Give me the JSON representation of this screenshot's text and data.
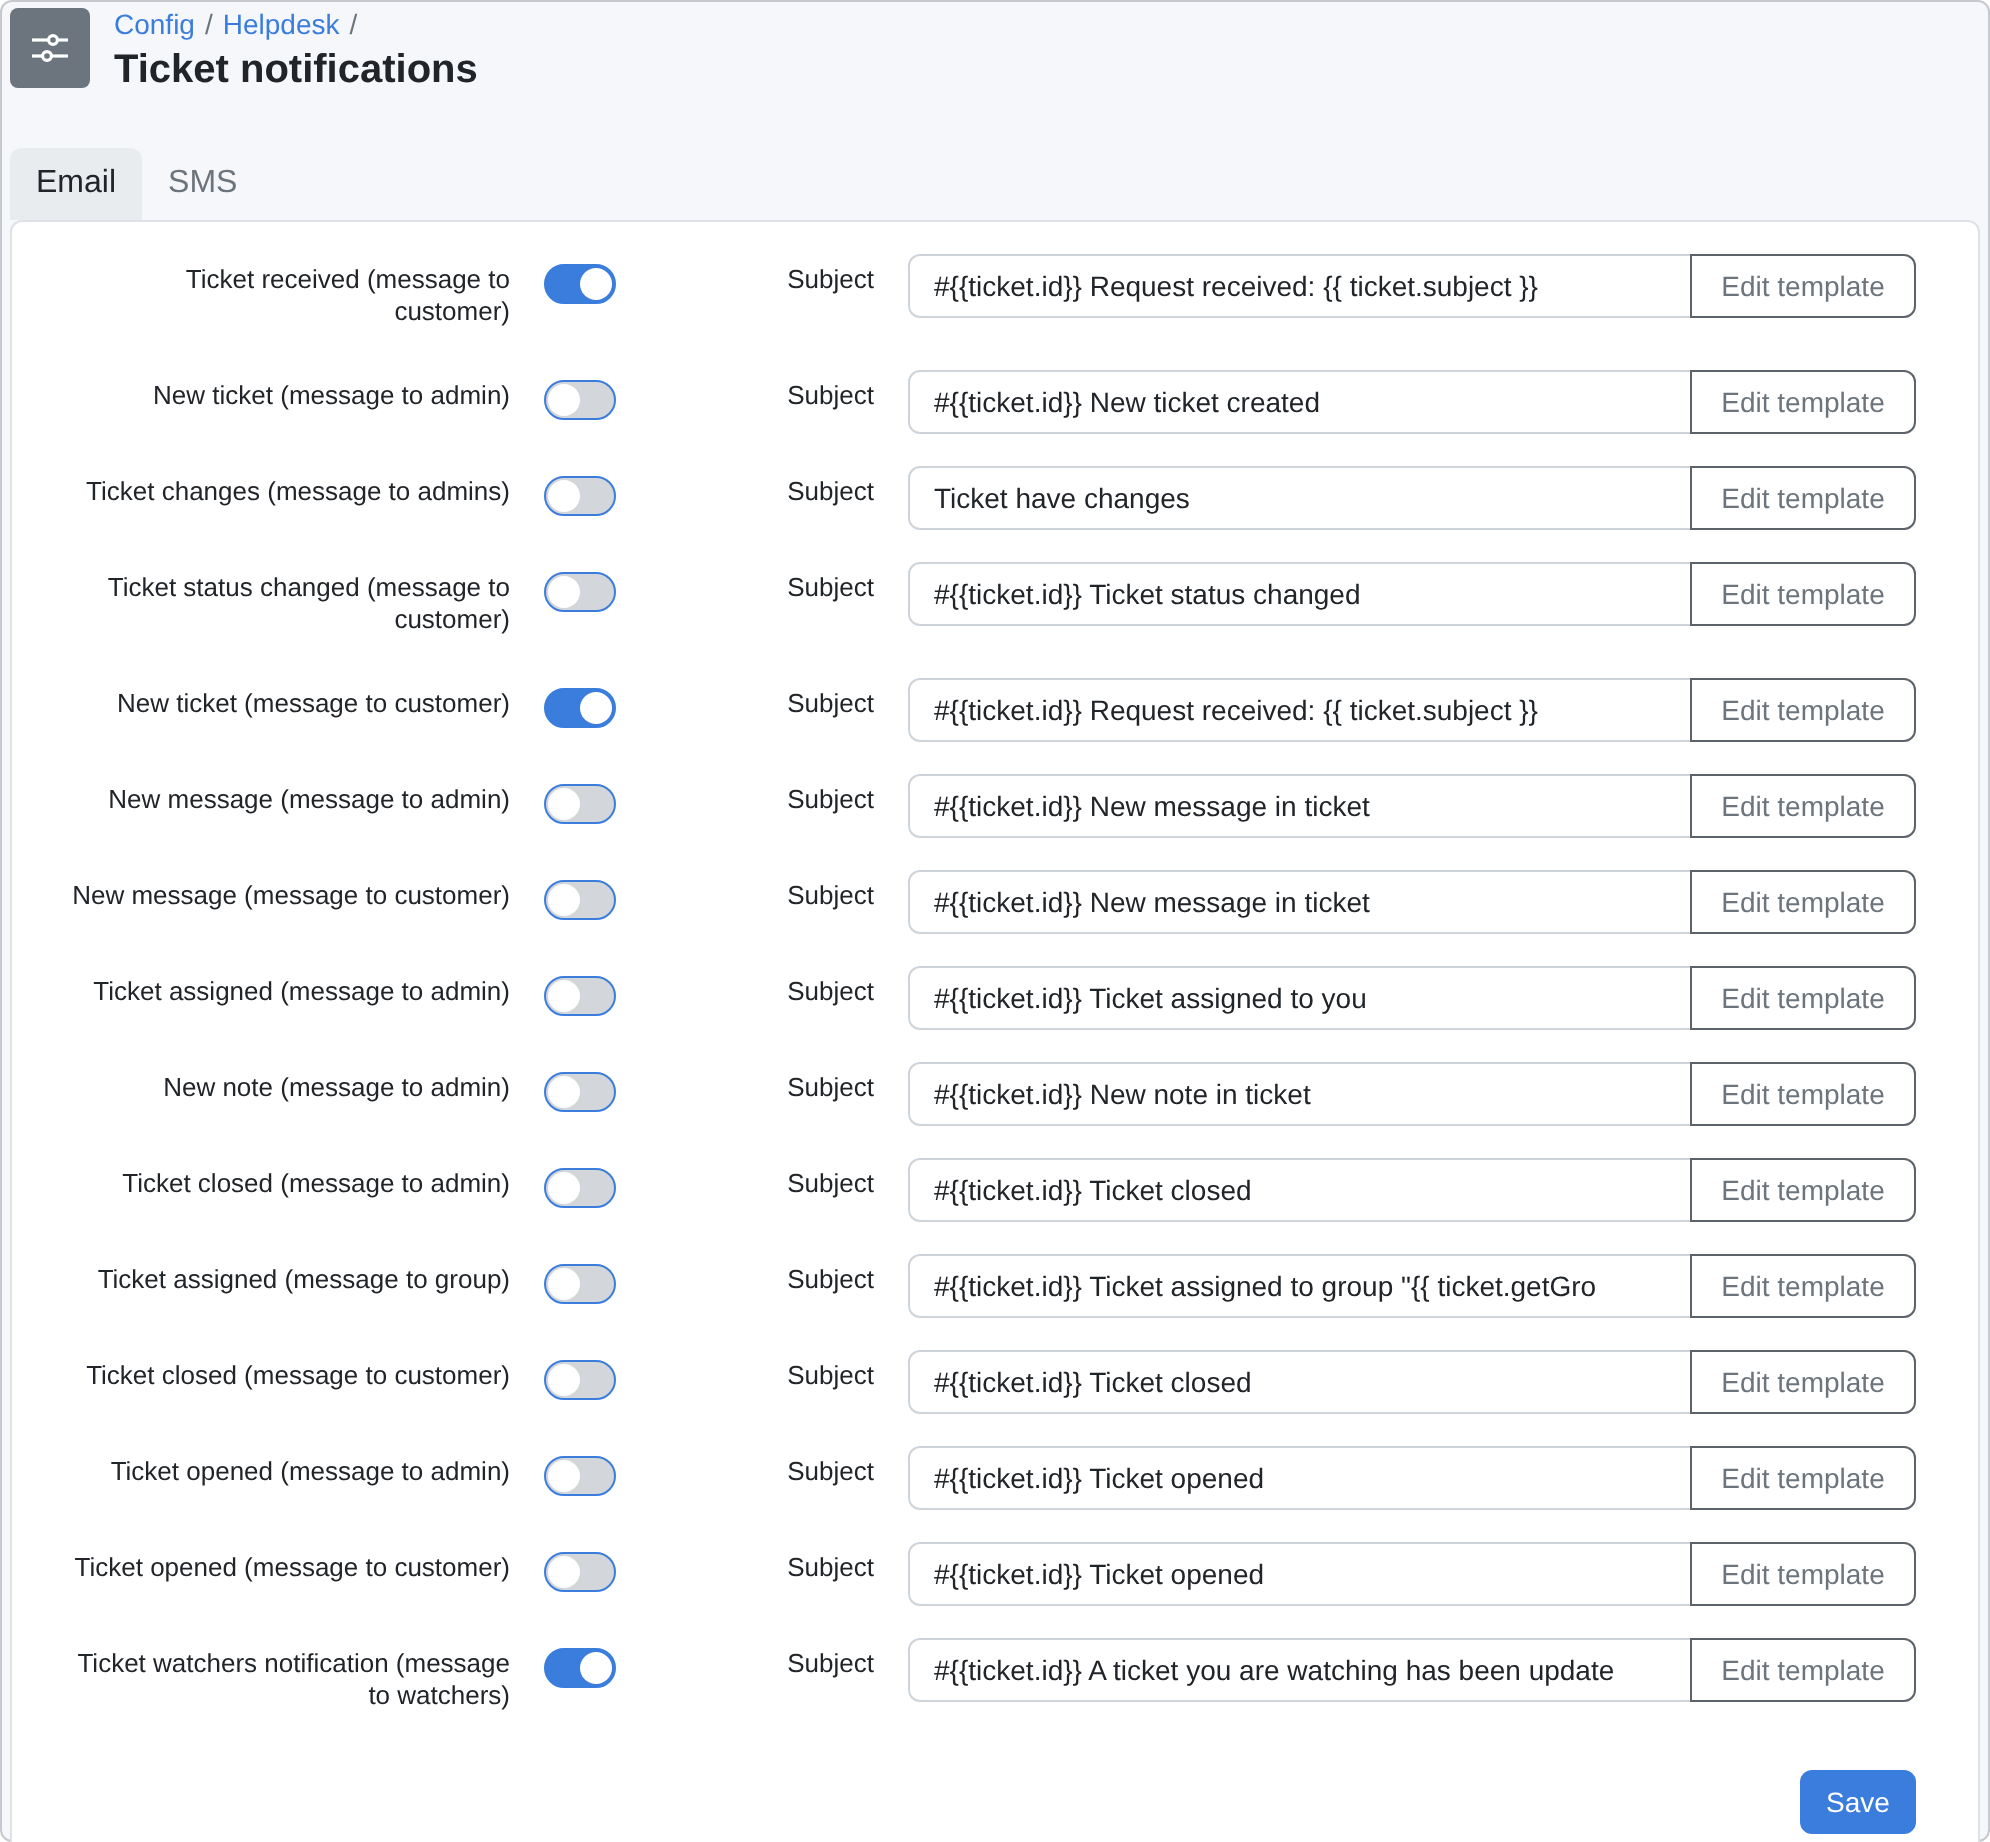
{
  "header": {
    "breadcrumb": [
      {
        "kind": "link",
        "label": "Config"
      },
      {
        "kind": "separator",
        "label": "/"
      },
      {
        "kind": "link",
        "label": "Helpdesk"
      },
      {
        "kind": "separator",
        "label": "/"
      }
    ],
    "title": "Ticket notifications"
  },
  "tabs": [
    {
      "label": "Email",
      "selected": true
    },
    {
      "label": "SMS",
      "selected": false
    }
  ],
  "notifications": [
    {
      "label": "Ticket received (message to customer)",
      "enabled": true,
      "subject_label": "Subject",
      "subject": "#{{ticket.id}} Request received: {{ ticket.subject }}",
      "button": "Edit template"
    },
    {
      "label": "New ticket (message to admin)",
      "enabled": false,
      "subject_label": "Subject",
      "subject": "#{{ticket.id}} New ticket created",
      "button": "Edit template"
    },
    {
      "label": "Ticket changes (message to admins)",
      "enabled": false,
      "subject_label": "Subject",
      "subject": "Ticket have changes",
      "button": "Edit template"
    },
    {
      "label": "Ticket status changed (message to customer)",
      "enabled": false,
      "subject_label": "Subject",
      "subject": "#{{ticket.id}} Ticket status changed",
      "button": "Edit template"
    },
    {
      "label": "New ticket (message to customer)",
      "enabled": true,
      "subject_label": "Subject",
      "subject": "#{{ticket.id}} Request received: {{ ticket.subject }}",
      "button": "Edit template"
    },
    {
      "label": "New message (message to admin)",
      "enabled": false,
      "subject_label": "Subject",
      "subject": "#{{ticket.id}} New message in ticket",
      "button": "Edit template"
    },
    {
      "label": "New message (message to customer)",
      "enabled": false,
      "subject_label": "Subject",
      "subject": "#{{ticket.id}} New message in ticket",
      "button": "Edit template"
    },
    {
      "label": "Ticket assigned (message to admin)",
      "enabled": false,
      "subject_label": "Subject",
      "subject": "#{{ticket.id}} Ticket assigned to you",
      "button": "Edit template"
    },
    {
      "label": "New note (message to admin)",
      "enabled": false,
      "subject_label": "Subject",
      "subject": "#{{ticket.id}} New note in ticket",
      "button": "Edit template"
    },
    {
      "label": "Ticket closed (message to admin)",
      "enabled": false,
      "subject_label": "Subject",
      "subject": "#{{ticket.id}} Ticket closed",
      "button": "Edit template"
    },
    {
      "label": "Ticket assigned (message to group)",
      "enabled": false,
      "subject_label": "Subject",
      "subject": "#{{ticket.id}} Ticket assigned to group \"{{ ticket.getGro",
      "button": "Edit template"
    },
    {
      "label": "Ticket closed (message to customer)",
      "enabled": false,
      "subject_label": "Subject",
      "subject": "#{{ticket.id}} Ticket closed",
      "button": "Edit template"
    },
    {
      "label": "Ticket opened (message to admin)",
      "enabled": false,
      "subject_label": "Subject",
      "subject": "#{{ticket.id}} Ticket opened",
      "button": "Edit template"
    },
    {
      "label": "Ticket opened (message to customer)",
      "enabled": false,
      "subject_label": "Subject",
      "subject": "#{{ticket.id}} Ticket opened",
      "button": "Edit template"
    },
    {
      "label": "Ticket watchers notification (message to watchers)",
      "enabled": true,
      "subject_label": "Subject",
      "subject": "#{{ticket.id}} A ticket you are watching has been update",
      "button": "Edit template"
    }
  ],
  "save_button": "Save"
}
